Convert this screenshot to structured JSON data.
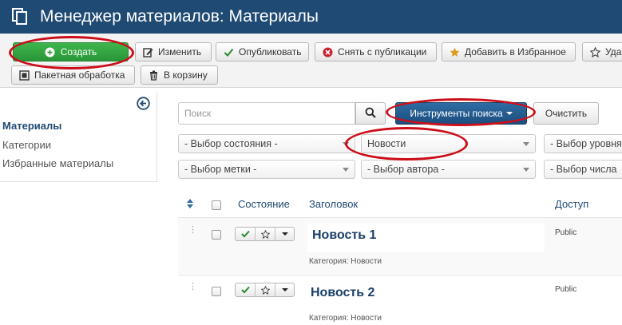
{
  "header": {
    "title": "Менеджер материалов: Материалы",
    "icon": "copy-icon"
  },
  "toolbar": {
    "create": "Создать",
    "edit": "Изменить",
    "publish": "Опубликовать",
    "unpublish": "Снять с публикации",
    "feature": "Добавить в Избранное",
    "unfeature": "Уда",
    "batch": "Пакетная обработка",
    "trash": "В корзину"
  },
  "sidebar": {
    "items": [
      {
        "label": "Материалы",
        "active": true
      },
      {
        "label": "Категории",
        "active": false
      },
      {
        "label": "Избранные материалы",
        "active": false
      }
    ]
  },
  "search": {
    "placeholder": "Поиск",
    "tools_label": "Инструменты поиска",
    "clear_label": "Очистить"
  },
  "filters": {
    "state": "- Выбор состояния -",
    "category": "Новости",
    "level": "- Выбор уровня",
    "tag": "- Выбор метки -",
    "author": "- Выбор автора -",
    "number": "- Выбор числа"
  },
  "table": {
    "headers": {
      "status": "Состояние",
      "title": "Заголовок",
      "access": "Доступ"
    },
    "rows": [
      {
        "title": "Новость 1",
        "category": "Категория: Новости",
        "access": "Public"
      },
      {
        "title": "Новость 2",
        "category": "Категория: Новости",
        "access": "Public"
      }
    ]
  },
  "colors": {
    "header_bg": "#1f4a73",
    "create_green": "#2a9638",
    "annotation_red": "#cc0e1a",
    "tools_blue": "#1c4e7e"
  }
}
